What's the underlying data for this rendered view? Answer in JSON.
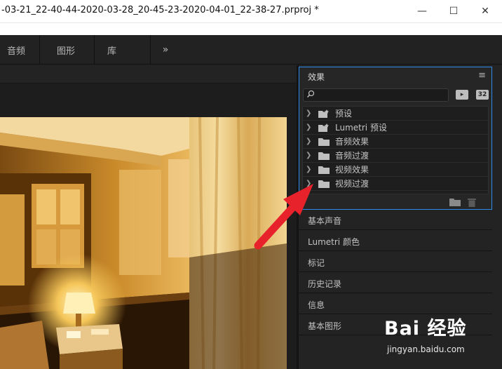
{
  "window": {
    "title": "-03-21_22-40-44-2020-03-28_20-45-23-2020-04-01_22-38-27.prproj *",
    "minimize": "—",
    "maximize": "☐",
    "close": "✕"
  },
  "workspace": {
    "tabs": [
      {
        "label": "音频"
      },
      {
        "label": "图形"
      },
      {
        "label": "库"
      }
    ],
    "more": "»"
  },
  "effects_panel": {
    "title": "效果",
    "menu": "≡",
    "search_placeholder": "",
    "filter_icons": [
      {
        "name": "accelerated-effects-icon",
        "label": "▸"
      },
      {
        "name": "32bit-effects-icon",
        "label": "32"
      }
    ],
    "items": [
      {
        "label": "预设",
        "icon": "preset-folder-icon"
      },
      {
        "label": "Lumetri 预设",
        "icon": "preset-folder-icon"
      },
      {
        "label": "音频效果",
        "icon": "folder-icon"
      },
      {
        "label": "音频过渡",
        "icon": "folder-icon"
      },
      {
        "label": "视频效果",
        "icon": "folder-icon"
      },
      {
        "label": "视频过渡",
        "icon": "folder-icon"
      }
    ]
  },
  "panels": [
    {
      "label": "基本声音"
    },
    {
      "label": "Lumetri 颜色"
    },
    {
      "label": "标记"
    },
    {
      "label": "历史记录"
    },
    {
      "label": "信息"
    },
    {
      "label": "基本图形"
    }
  ],
  "watermark": {
    "text": "Bai 经验",
    "url": "jingyan.baidu.com"
  },
  "colors": {
    "accent": "#2d8ceb",
    "arrow": "#e8222b",
    "panel_bg": "#232323"
  }
}
